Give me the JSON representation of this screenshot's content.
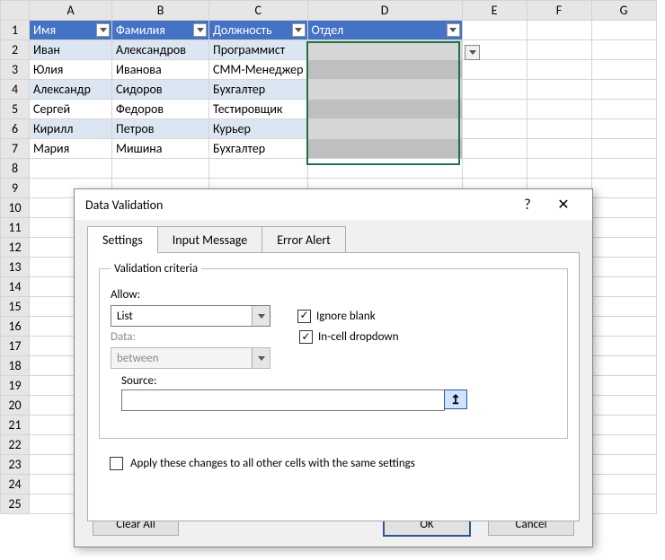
{
  "sheet": {
    "columns": [
      "A",
      "B",
      "C",
      "D",
      "E",
      "F",
      "G"
    ],
    "row_numbers": [
      1,
      2,
      3,
      4,
      5,
      6,
      7,
      8,
      9,
      10,
      11,
      12,
      13,
      14,
      15,
      16,
      17,
      18,
      19,
      20,
      21,
      22,
      23,
      24,
      25
    ],
    "headers": [
      "Имя",
      "Фамилия",
      "Должность",
      "Отдел"
    ],
    "rows": [
      [
        "Иван",
        "Александров",
        "Программист",
        ""
      ],
      [
        "Юлия",
        "Иванова",
        "СММ-Менеджер",
        ""
      ],
      [
        "Александр",
        "Сидоров",
        "Бухгалтер",
        ""
      ],
      [
        "Сергей",
        "Федоров",
        "Тестировщик",
        ""
      ],
      [
        "Кирилл",
        "Петров",
        "Курьер",
        ""
      ],
      [
        "Мария",
        "Мишина",
        "Бухгалтер",
        ""
      ]
    ]
  },
  "dialog": {
    "title": "Data Validation",
    "tabs": {
      "settings": "Settings",
      "input_message": "Input Message",
      "error_alert": "Error Alert"
    },
    "criteria_legend": "Validation criteria",
    "allow_label": "Allow:",
    "allow_value": "List",
    "data_label": "Data:",
    "data_value": "between",
    "ignore_blank": "Ignore blank",
    "incell_dropdown": "In-cell dropdown",
    "source_label": "Source:",
    "source_value": "",
    "apply_label": "Apply these changes to all other cells with the same settings",
    "clear_all": "Clear All",
    "ok": "OK",
    "cancel": "Cancel"
  }
}
